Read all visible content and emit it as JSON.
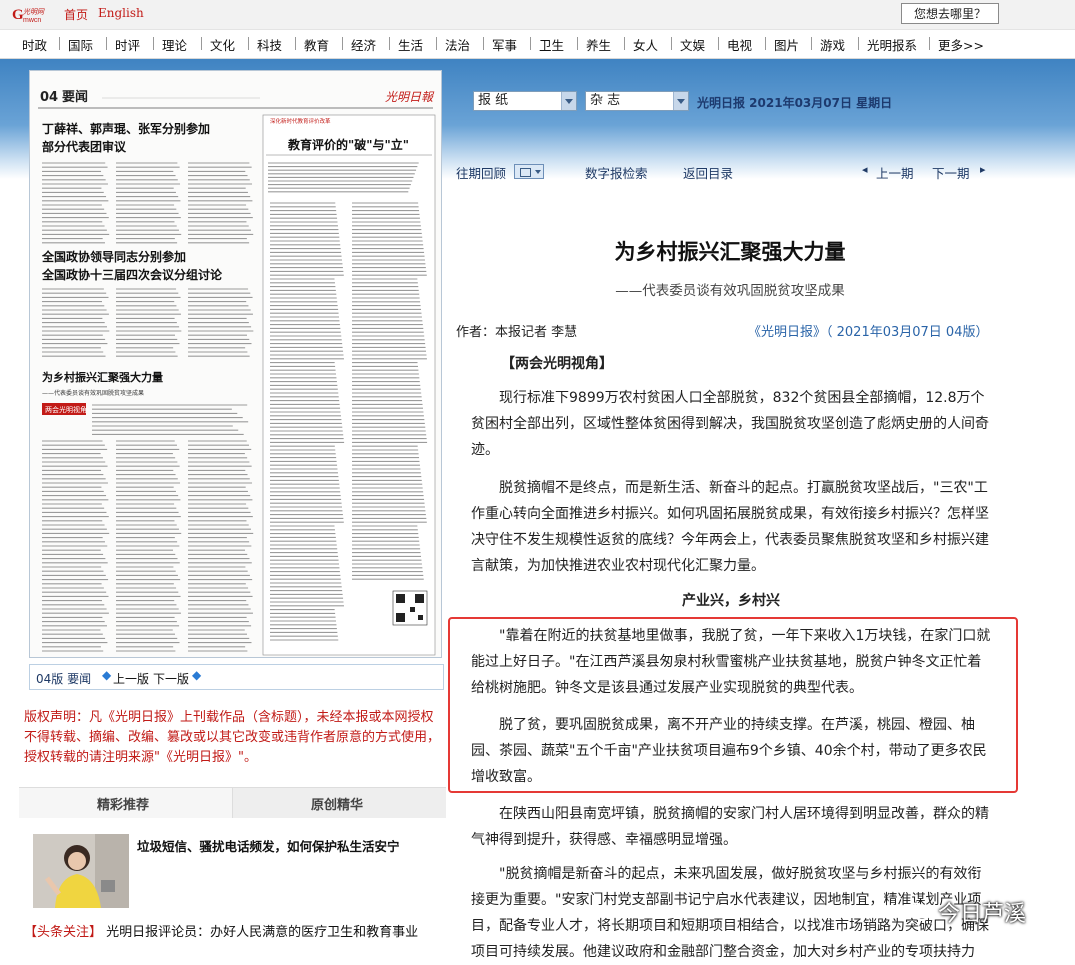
{
  "topbar": {
    "home": "首页",
    "english": "English",
    "search_placeholder": "您想去哪里？"
  },
  "nav": [
    "时政",
    "国际",
    "时评",
    "理论",
    "文化",
    "科技",
    "教育",
    "经济",
    "生活",
    "法治",
    "军事",
    "卫生",
    "养生",
    "女人",
    "文娱",
    "电视",
    "图片",
    "游戏",
    "光明报系",
    "更多>>"
  ],
  "selectors": {
    "paper": "报  纸",
    "magazine": "杂  志",
    "date_label": "光明日报  2021年03月07日  星期日"
  },
  "toolbar": {
    "past": "往期回顾",
    "digital_search": "数字报检索",
    "back_index": "返回目录",
    "prev_issue": "上一期",
    "next_issue": "下一期"
  },
  "paper_page": {
    "page_no": "04",
    "page_name": "要闻",
    "headline1a": "丁薛祥、郭声琨、张军分别参加",
    "headline1b": "部分代表团审议",
    "headline2a": "全国政协领导同志分别参加",
    "headline2b": "全国政协十三届四次会议分组讨论",
    "headline3": "为乡村振兴汇聚强大力量",
    "headline3_sub": "——代表委员谈有效巩固脱贫攻坚成果",
    "section_tag": "两会光明视角",
    "right_title": "教育评价的\"破\"与\"立\"",
    "banner_label": "深化新时代教育评价改革"
  },
  "pagebar": {
    "label": "04版 要闻",
    "prev": "上一版",
    "next": "下一版"
  },
  "copyright": "版权声明：凡《光明日报》上刊载作品（含标题），未经本报或本网授权不得转载、摘编、改编、篡改或以其它改变或违背作者原意的方式使用，授权转载的请注明来源\"《光明日报》\"。",
  "recommend": {
    "tab1": "精彩推荐",
    "tab2": "原创精华",
    "item_title": "垃圾短信、骚扰电话频发，如何保护私生活安宁",
    "headline_tag": "【头条关注】",
    "headline_text": "光明日报评论员：办好人民满意的医疗卫生和教育事业"
  },
  "article": {
    "title": "为乡村振兴汇聚强大力量",
    "subtitle": "——代表委员谈有效巩固脱贫攻坚成果",
    "byline": "作者：本报记者 李慧",
    "source": "《光明日报》（ 2021年03月07日   04版）",
    "tag": "【两会光明视角】",
    "p1": "现行标准下9899万农村贫困人口全部脱贫，832个贫困县全部摘帽，12.8万个贫困村全部出列，区域性整体贫困得到解决，我国脱贫攻坚创造了彪炳史册的人间奇迹。",
    "p2": "脱贫摘帽不是终点，而是新生活、新奋斗的起点。打赢脱贫攻坚战后，\"三农\"工作重心转向全面推进乡村振兴。如何巩固拓展脱贫成果，有效衔接乡村振兴？怎样坚决守住不发生规模性返贫的底线？今年两会上，代表委员聚焦脱贫攻坚和乡村振兴建言献策，为加快推进农业农村现代化汇聚力量。",
    "section": "产业兴，乡村兴",
    "p3": "\"靠着在附近的扶贫基地里做事，我脱了贫，一年下来收入1万块钱，在家门口就能过上好日子。\"在江西芦溪县匆泉村秋雪蜜桃产业扶贫基地，脱贫户钟冬文正忙着给桃树施肥。钟冬文是该县通过发展产业实现脱贫的典型代表。",
    "p4": "脱了贫，要巩固脱贫成果，离不开产业的持续支撑。在芦溪，桃园、橙园、柚园、茶园、蔬菜\"五个千亩\"产业扶贫项目遍布9个乡镇、40余个村，带动了更多农民增收致富。",
    "p5": "在陕西山阳县南宽坪镇，脱贫摘帽的安家门村人居环境得到明显改善，群众的精气神得到提升，获得感、幸福感明显增强。",
    "p6": "\"脱贫摘帽是新奋斗的起点，未来巩固发展，做好脱贫攻坚与乡村振兴的有效衔接更为重要。\"安家门村党支部副书记宁启水代表建议，因地制宜，精准谋划产业项目，配备专业人才，将长期项目和短期项目相结合，以找准市场销路为突破口，确保项目可持续发展。他建议政府和金融部门整合资金，加大对乡村产业的专项扶持力"
  },
  "watermark": "今日芦溪"
}
